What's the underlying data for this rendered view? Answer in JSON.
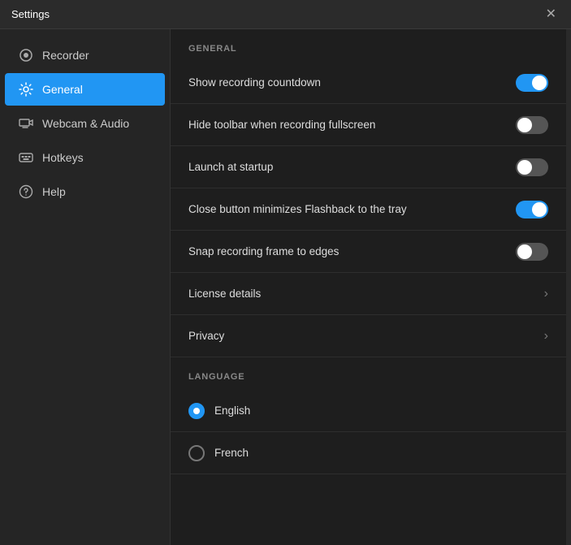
{
  "titleBar": {
    "title": "Settings",
    "closeLabel": "✕"
  },
  "sidebar": {
    "items": [
      {
        "id": "recorder",
        "label": "Recorder",
        "icon": "recorder"
      },
      {
        "id": "general",
        "label": "General",
        "icon": "general",
        "active": true
      },
      {
        "id": "webcam-audio",
        "label": "Webcam & Audio",
        "icon": "webcam"
      },
      {
        "id": "hotkeys",
        "label": "Hotkeys",
        "icon": "hotkeys"
      },
      {
        "id": "help",
        "label": "Help",
        "icon": "help"
      }
    ]
  },
  "content": {
    "generalSection": "GENERAL",
    "settings": [
      {
        "id": "show-recording-countdown",
        "label": "Show recording countdown",
        "type": "toggle",
        "value": true
      },
      {
        "id": "hide-toolbar",
        "label": "Hide toolbar when recording fullscreen",
        "type": "toggle",
        "value": false
      },
      {
        "id": "launch-at-startup",
        "label": "Launch at startup",
        "type": "toggle",
        "value": false
      },
      {
        "id": "close-button-minimizes",
        "label": "Close button minimizes Flashback to the tray",
        "type": "toggle",
        "value": true
      },
      {
        "id": "snap-recording-frame",
        "label": "Snap recording frame to edges",
        "type": "toggle",
        "value": false
      }
    ],
    "links": [
      {
        "id": "license-details",
        "label": "License details"
      },
      {
        "id": "privacy",
        "label": "Privacy"
      }
    ],
    "languageSection": "LANGUAGE",
    "languages": [
      {
        "id": "english",
        "label": "English",
        "selected": true
      },
      {
        "id": "french",
        "label": "French",
        "selected": false
      }
    ]
  }
}
